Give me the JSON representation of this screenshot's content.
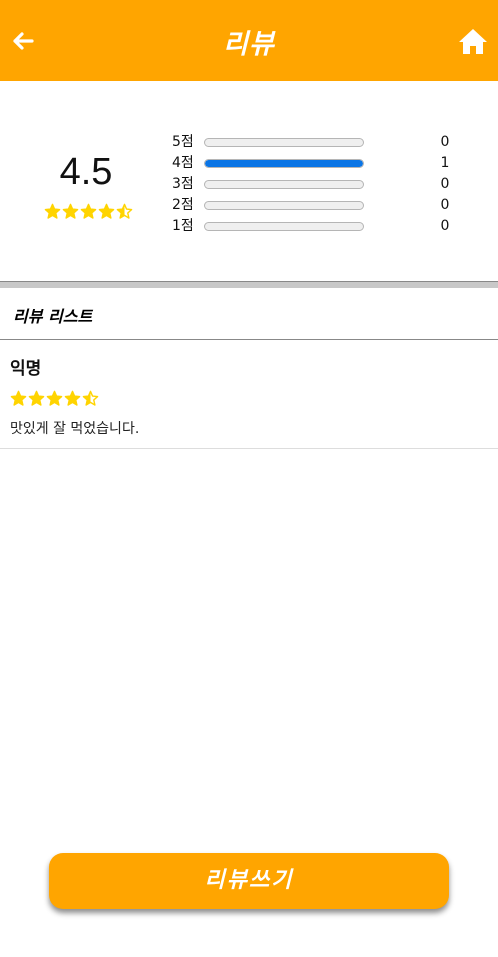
{
  "header": {
    "title": "리뷰",
    "back_icon": "back-arrow-icon",
    "home_icon": "home-icon",
    "bg_color": "#FFA500"
  },
  "summary": {
    "average": "4.5",
    "average_rating_value": 4.5,
    "star_color": "#FFD400",
    "distribution": [
      {
        "label": "5점",
        "count": "0",
        "fraction": 0
      },
      {
        "label": "4점",
        "count": "1",
        "fraction": 1
      },
      {
        "label": "3점",
        "count": "0",
        "fraction": 0
      },
      {
        "label": "2점",
        "count": "0",
        "fraction": 0
      },
      {
        "label": "1점",
        "count": "0",
        "fraction": 0
      }
    ],
    "bar_fill_color": "#0A75E6"
  },
  "review_list": {
    "title": "리뷰 리스트",
    "items": [
      {
        "author": "익명",
        "rating_value": 4.5,
        "text": "맛있게 잘 먹었습니다."
      }
    ]
  },
  "write_button": {
    "label": "리뷰쓰기"
  }
}
